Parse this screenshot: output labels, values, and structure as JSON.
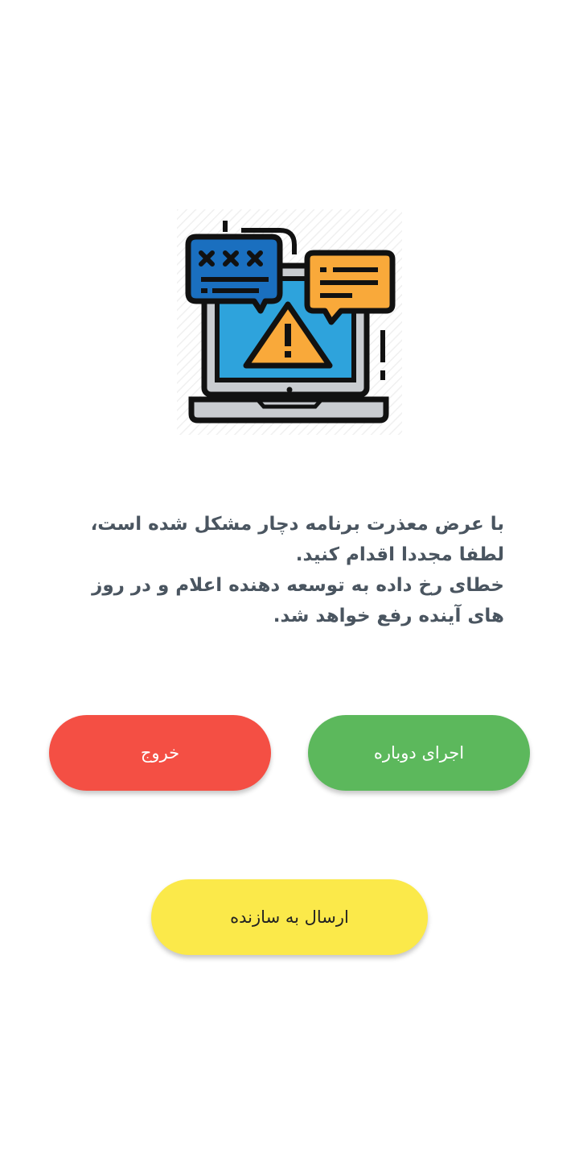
{
  "error_screen": {
    "illustration": "laptop-warning-chat-bubbles-icon",
    "message_line1": "با عرض معذرت برنامه دچار مشکل شده است، لطفا مجددا اقدام کنید.",
    "message_line2": "خطای رخ داده به توسعه دهنده اعلام و در روز های آینده رفع خواهد شد."
  },
  "buttons": {
    "retry_label": "اجرای دوباره",
    "exit_label": "خروج",
    "send_label": "ارسال به سازنده"
  },
  "colors": {
    "retry": "#5cb85c",
    "exit": "#f44f44",
    "send": "#fbe94a",
    "text": "#4a5560",
    "screen_blue": "#2ea3dc",
    "bubble_blue": "#1a6fbf",
    "bubble_orange": "#f9a93a"
  }
}
